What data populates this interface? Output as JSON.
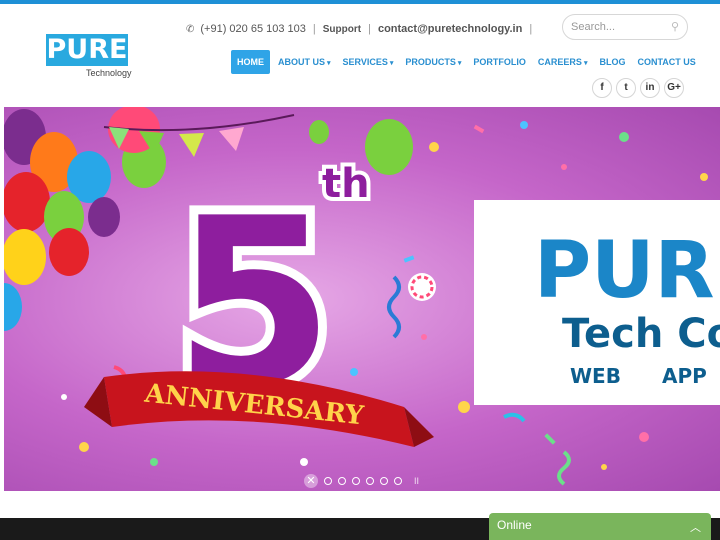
{
  "header": {
    "logo_text": "PURE",
    "logo_subtext": "Technology",
    "phone_icon": "phone-icon",
    "phone": "(+91) 020 65 103 103",
    "support_label": "Support",
    "email": "contact@puretechnology.in",
    "search_placeholder": "Search...",
    "search_icon": "search-icon"
  },
  "nav": {
    "items": [
      {
        "label": "HOME",
        "active": true
      },
      {
        "label": "ABOUT US",
        "dropdown": true
      },
      {
        "label": "SERVICES",
        "dropdown": true
      },
      {
        "label": "PRODUCTS",
        "dropdown": true
      },
      {
        "label": "PORTFOLIO"
      },
      {
        "label": "CAREERS",
        "dropdown": true
      },
      {
        "label": "BLOG"
      },
      {
        "label": "CONTACT US"
      }
    ],
    "caret": "▾"
  },
  "socials": [
    {
      "icon": "facebook-icon",
      "glyph": "f"
    },
    {
      "icon": "twitter-icon",
      "glyph": "t"
    },
    {
      "icon": "linkedin-icon",
      "glyph": "in"
    },
    {
      "icon": "google-plus-icon",
      "glyph": "G+"
    }
  ],
  "hero": {
    "number": "5",
    "suffix": "th",
    "ribbon": "ANNIVERSARY",
    "card_title": "PURE",
    "card_sub": "Tech Co",
    "card_word1": "WEB",
    "card_word2": "APP",
    "slide_count": 7,
    "active_slide": 1,
    "pause_glyph": "II",
    "close_glyph": "✕"
  },
  "chat": {
    "label": "Online",
    "caret": "︿"
  },
  "colors": {
    "brand_blue": "#29a9df",
    "nav_blue": "#2a8fd0",
    "hero_purple": "#c566c9",
    "chat_green": "#7ab55c"
  }
}
